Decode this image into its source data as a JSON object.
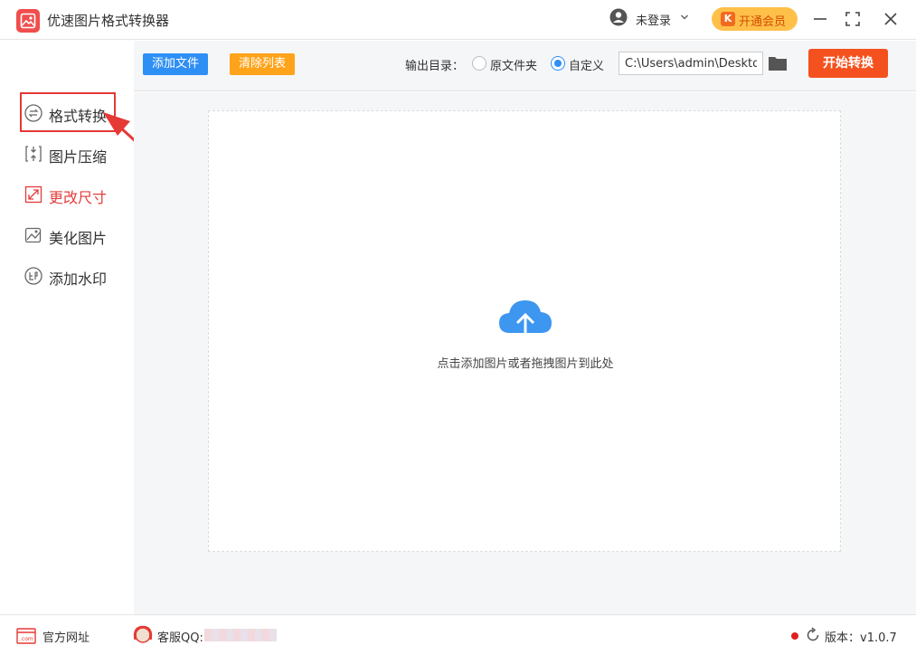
{
  "app": {
    "title": "优速图片格式转换器"
  },
  "header": {
    "user_status": "未登录",
    "vip_label": "开通会员",
    "vip_icon_letter": "K"
  },
  "sidebar": {
    "items": [
      {
        "label": "格式转换",
        "icon": "format-convert-icon",
        "active": true
      },
      {
        "label": "图片压缩",
        "icon": "compress-icon"
      },
      {
        "label": "更改尺寸",
        "icon": "resize-icon",
        "color": "#e33b3b"
      },
      {
        "label": "美化图片",
        "icon": "beautify-icon"
      },
      {
        "label": "添加水印",
        "icon": "watermark-icon"
      }
    ]
  },
  "toolbar": {
    "add_files": "添加文件",
    "clear_list": "清除列表",
    "output_dir_label": "输出目录：",
    "option_original": "原文件夹",
    "option_custom": "自定义",
    "selected_option": "自定义",
    "output_path": "C:\\Users\\admin\\Deskto",
    "start_button": "开始转换"
  },
  "main": {
    "drop_hint": "点击添加图片或者拖拽图片到此处"
  },
  "footer": {
    "site_link": "官方网址",
    "cs_label": "客服QQ:",
    "version": "版本：v1.0.7"
  },
  "colors": {
    "accent_blue": "#2e8ff5",
    "accent_orange": "#ffa31a",
    "start_red": "#f4511e",
    "highlight_red": "#e53935"
  }
}
